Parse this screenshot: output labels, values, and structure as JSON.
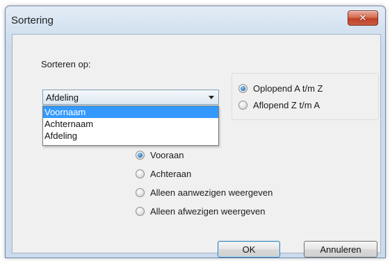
{
  "window": {
    "title": "Sortering",
    "close_glyph": "✕"
  },
  "sort_by": {
    "label": "Sorteren op:",
    "selected_value": "Afdeling",
    "options": [
      "Voornaam",
      "Achternaam",
      "Afdeling"
    ],
    "highlighted_option": "Voornaam"
  },
  "order": {
    "options": [
      {
        "label": "Oplopend A t/m Z",
        "checked": true
      },
      {
        "label": "Aflopend  Z t/m A",
        "checked": false
      }
    ]
  },
  "presence": {
    "options": [
      {
        "label": "Vooraan",
        "checked": true
      },
      {
        "label": "Achteraan",
        "checked": false
      },
      {
        "label": "Alleen aanwezigen weergeven",
        "checked": false
      },
      {
        "label": "Alleen afwezigen weergeven",
        "checked": false
      }
    ]
  },
  "buttons": {
    "ok": "OK",
    "cancel": "Annuleren"
  },
  "colors": {
    "selection": "#3399ff",
    "close_button": "#c75b40"
  }
}
